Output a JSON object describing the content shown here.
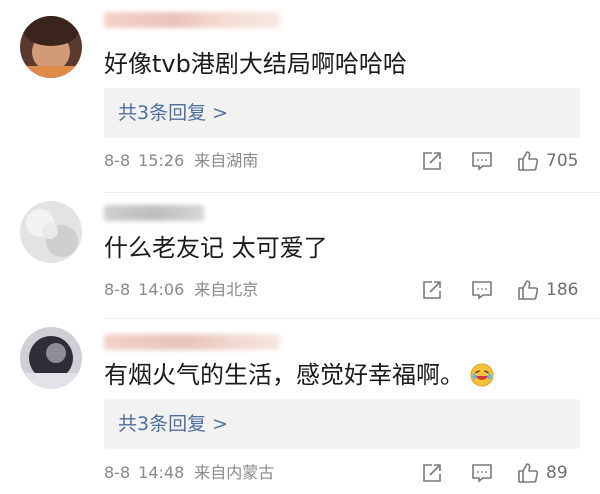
{
  "comments": [
    {
      "text": "好像tvb港剧大结局啊哈哈哈",
      "reply": {
        "label": "共3条回复 >"
      },
      "date": "8-8",
      "time": "15:26",
      "location": "来自湖南",
      "likes": "705",
      "avatar_colors": [
        "#4a2f26",
        "#c48a6a",
        "#e6b79a"
      ]
    },
    {
      "text": "什么老友记 太可爱了",
      "date": "8-8",
      "time": "14:06",
      "location": "来自北京",
      "likes": "186",
      "avatar_colors": [
        "#d9d9d9",
        "#eeeeee",
        "#bfbfbf"
      ]
    },
    {
      "text": "有烟火气的生活，感觉好幸福啊。",
      "emoji": "laughing-face",
      "reply": {
        "label": "共3条回复 >"
      },
      "date": "8-8",
      "time": "14:48",
      "location": "来自内蒙古",
      "likes": "89",
      "avatar_colors": [
        "#2b2b33",
        "#8e8e99",
        "#cfcfd6"
      ]
    }
  ],
  "colors": {
    "link": "#4f6fa0",
    "meta": "#8a8a8a",
    "reply_bg": "#f2f2f2"
  }
}
